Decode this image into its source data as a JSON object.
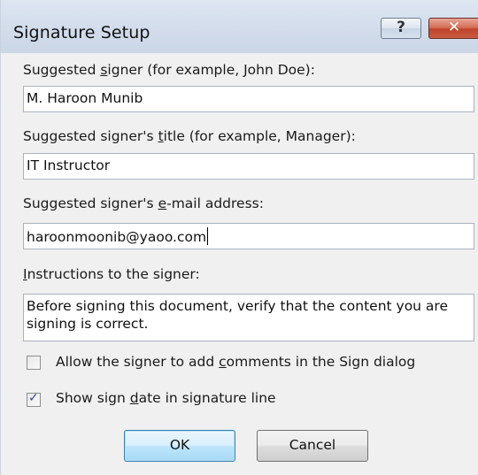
{
  "dialog": {
    "title": "Signature Setup",
    "help_glyph": "?",
    "close_glyph": "✕"
  },
  "fields": {
    "signer_label": [
      "Suggested ",
      "s",
      "igner (for example, John Doe):"
    ],
    "signer_value": "M. Haroon Munib",
    "title_label": [
      "Suggested signer's ",
      "t",
      "itle (for example, Manager):"
    ],
    "title_value": "IT Instructor",
    "email_label": [
      "Suggested signer's ",
      "e",
      "-mail address:"
    ],
    "email_value": "haroonmoonib@yaoo.com",
    "instructions_label": [
      "",
      "I",
      "nstructions to the signer:"
    ],
    "instructions_value": "Before signing this document, verify that the content you are signing is correct."
  },
  "options": {
    "allow_comments": {
      "label": [
        "Allow the signer to add ",
        "c",
        "omments in the Sign dialog"
      ],
      "checked": false
    },
    "show_date": {
      "label": [
        "Show sign ",
        "d",
        "ate in signature line"
      ],
      "checked": true,
      "check_glyph": "✓"
    }
  },
  "buttons": {
    "ok": "OK",
    "cancel": "Cancel"
  }
}
